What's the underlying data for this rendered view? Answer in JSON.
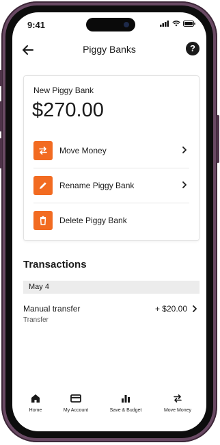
{
  "status": {
    "time": "9:41"
  },
  "header": {
    "title": "Piggy Banks",
    "help_symbol": "?"
  },
  "card": {
    "bank_name": "New Piggy Bank",
    "balance": "$270.00",
    "actions": [
      {
        "label": "Move Money",
        "icon": "swap-arrows-icon",
        "has_chevron": true
      },
      {
        "label": "Rename Piggy Bank",
        "icon": "pencil-icon",
        "has_chevron": true
      },
      {
        "label": "Delete Piggy Bank",
        "icon": "trash-icon",
        "has_chevron": false
      }
    ]
  },
  "transactions": {
    "heading": "Transactions",
    "groups": [
      {
        "date": "May 4",
        "items": [
          {
            "title": "Manual transfer",
            "subtitle": "Transfer",
            "amount": "+ $20.00"
          }
        ]
      }
    ]
  },
  "bottom_nav": {
    "items": [
      {
        "label": "Home",
        "icon": "home-icon"
      },
      {
        "label": "My Account",
        "icon": "card-icon"
      },
      {
        "label": "Save & Budget",
        "icon": "bar-chart-icon"
      },
      {
        "label": "Move Money",
        "icon": "swap-arrows-icon"
      }
    ]
  },
  "colors": {
    "accent": "#f26b21",
    "frame": "#6a4a64",
    "text": "#1a1a1a",
    "date_bar": "#ececec"
  }
}
